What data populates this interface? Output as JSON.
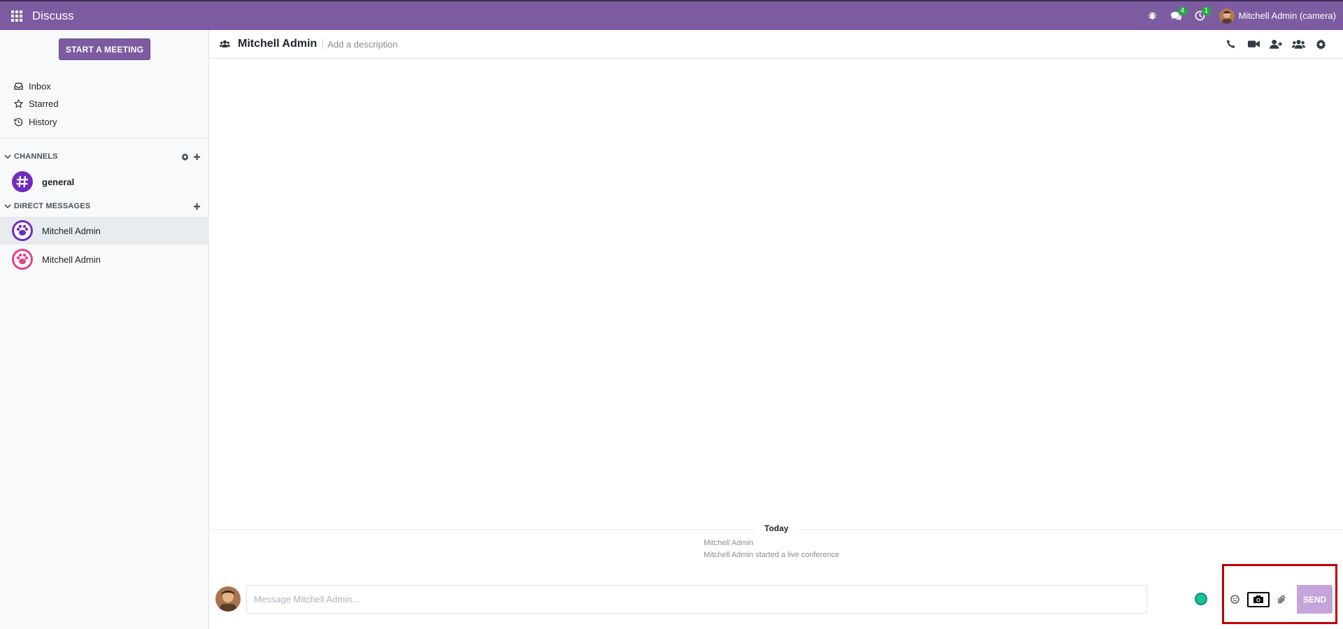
{
  "navbar": {
    "app_name": "Discuss",
    "messages_count": "4",
    "activities_count": "1",
    "user_label": "Mitchell Admin (camera)",
    "background": "#7c5ba1"
  },
  "sidebar": {
    "start_meeting_label": "START A MEETING",
    "mailboxes": [
      {
        "label": "Inbox",
        "icon": "inbox-icon"
      },
      {
        "label": "Starred",
        "icon": "star-icon"
      },
      {
        "label": "History",
        "icon": "history-icon"
      }
    ],
    "channels_title": "CHANNELS",
    "channels": [
      {
        "name": "general"
      }
    ],
    "direct_messages_title": "DIRECT MESSAGES",
    "direct_messages": [
      {
        "name": "Mitchell Admin",
        "active": true,
        "avatar_color": "#6f2dbd"
      },
      {
        "name": "Mitchell Admin",
        "active": false,
        "avatar_color": "#e83e8c"
      }
    ]
  },
  "thread": {
    "title": "Mitchell Admin",
    "description_placeholder": "Add a description",
    "date_separator": "Today",
    "notification": {
      "author": "Mitchell Admin",
      "text": "Mitchell Admin started a live conference"
    }
  },
  "composer": {
    "placeholder": "Message Mitchell Admin...",
    "send_label": "SEND"
  },
  "colors": {
    "brand": "#7c5ba1",
    "send_disabled": "#c6a4db",
    "badge": "#28a745",
    "highlight": "#c00000"
  }
}
